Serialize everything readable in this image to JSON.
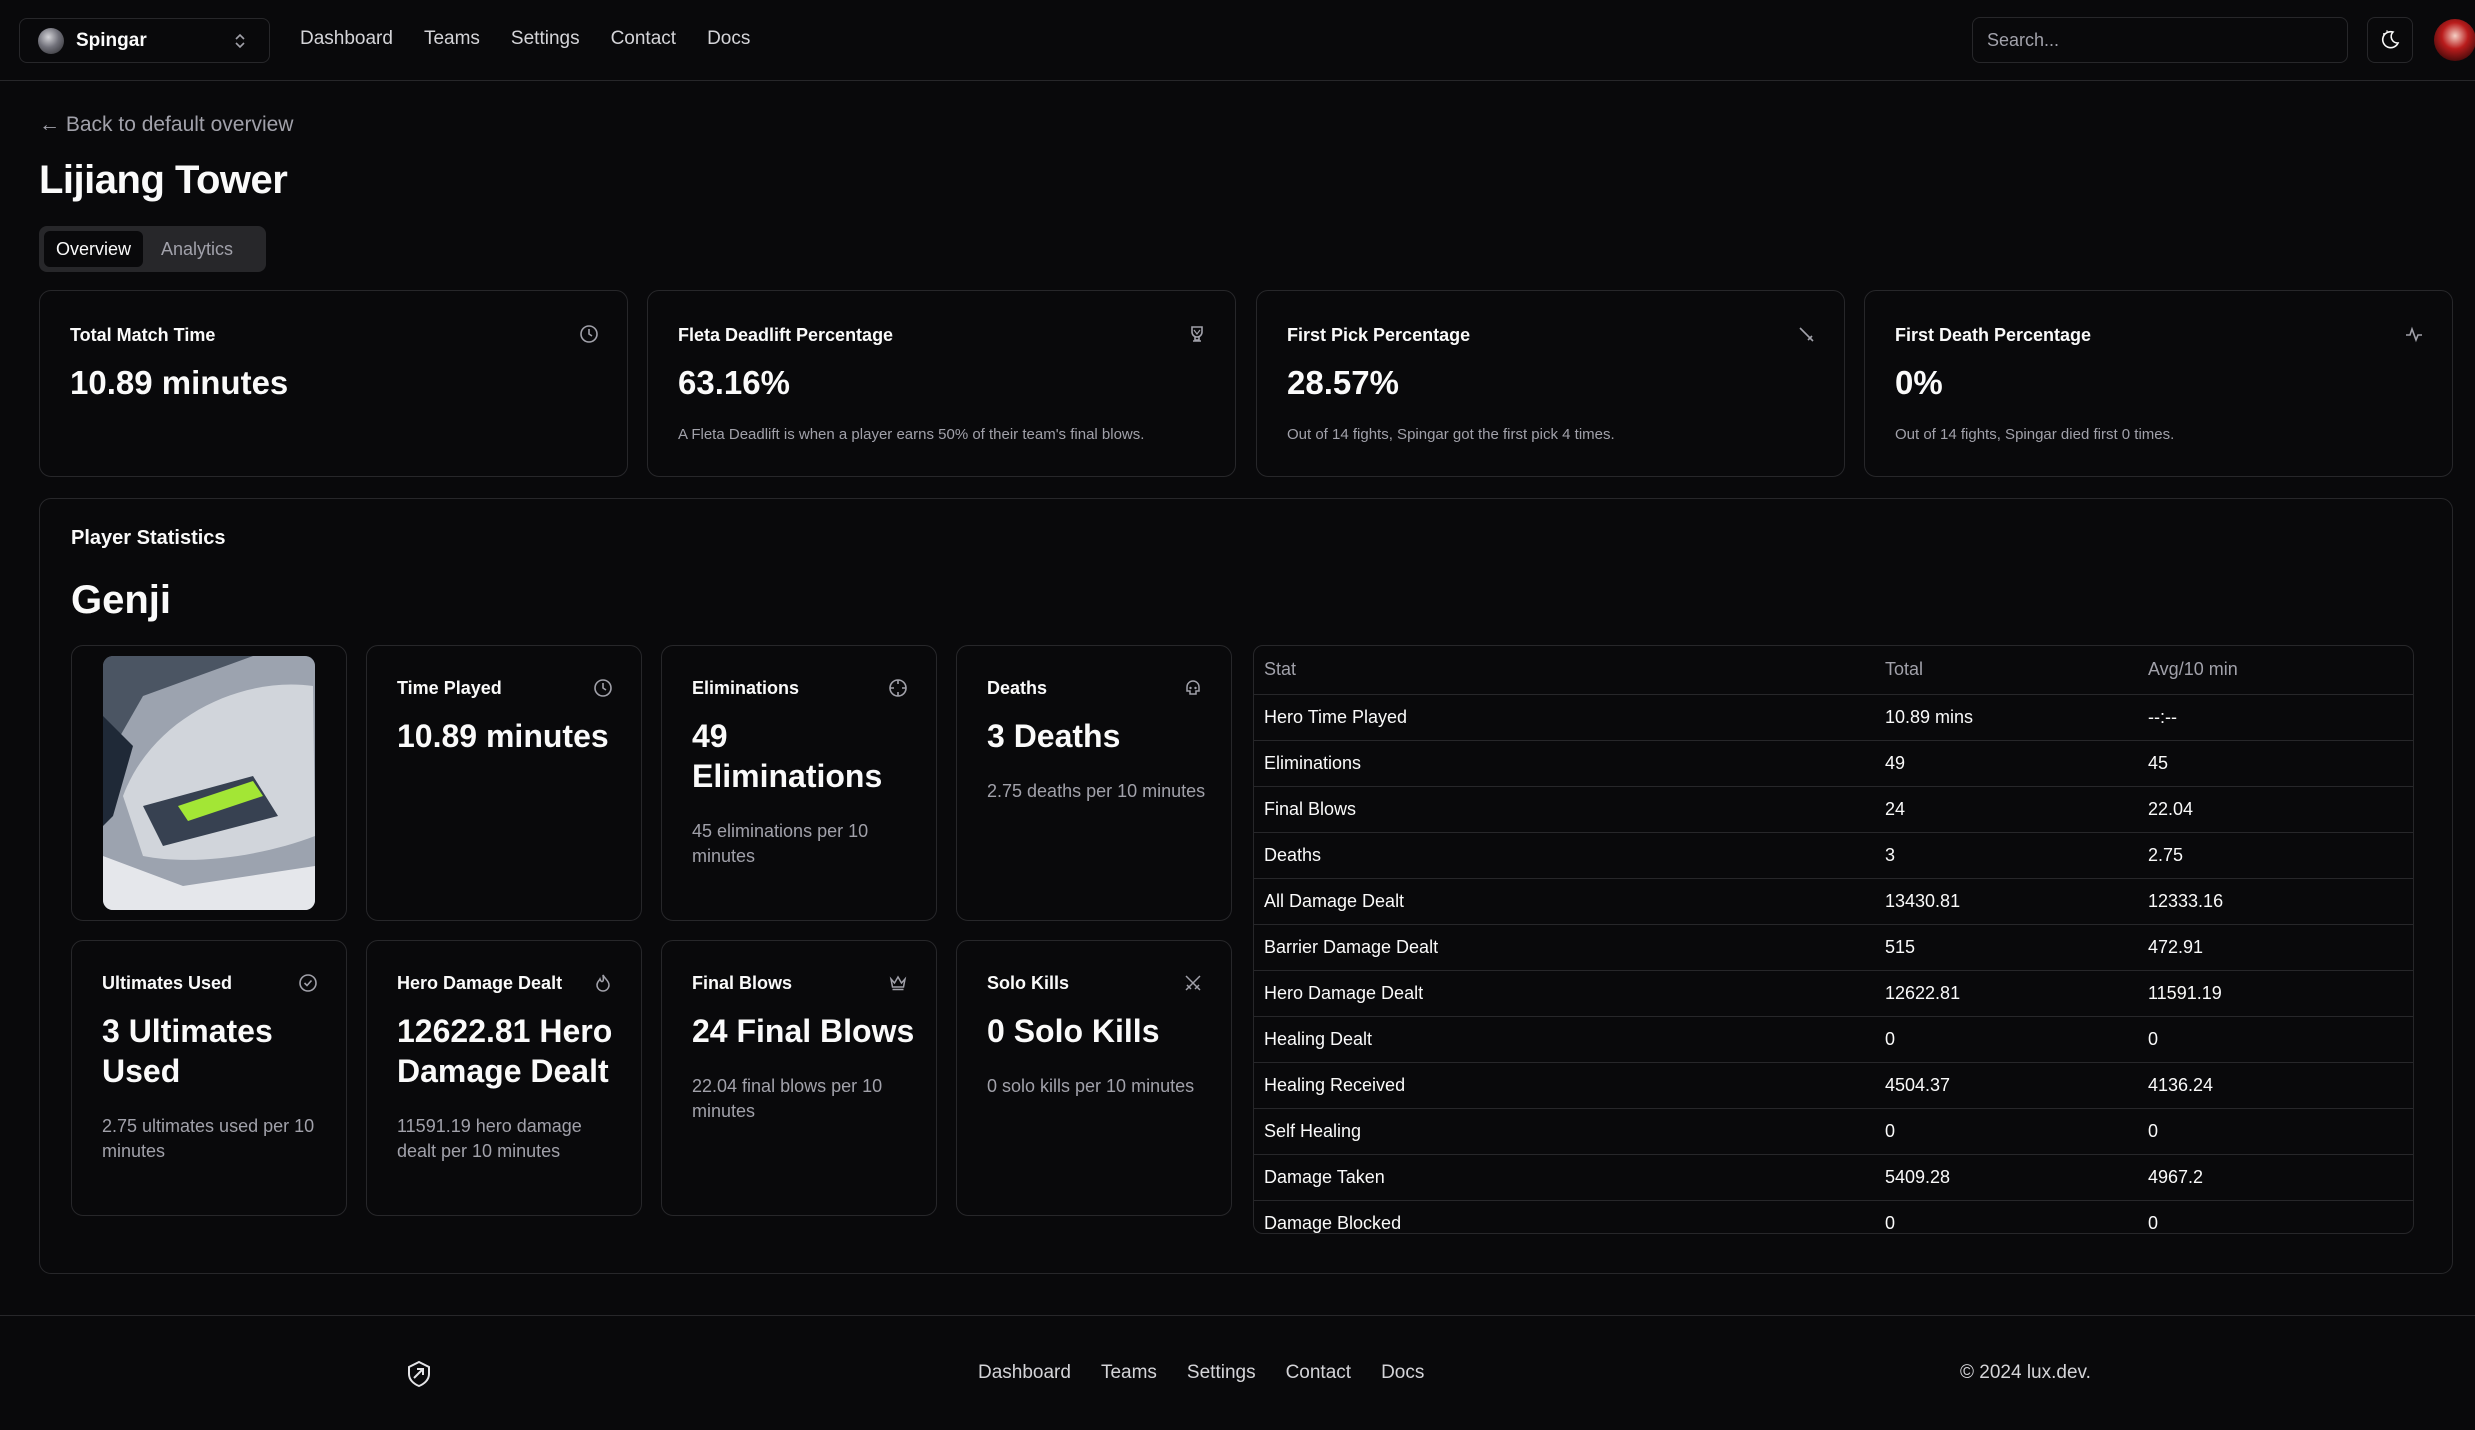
{
  "team": {
    "name": "Spingar"
  },
  "nav": [
    "Dashboard",
    "Teams",
    "Settings",
    "Contact",
    "Docs"
  ],
  "search": {
    "placeholder": "Search..."
  },
  "back_link": "← Back to default overview",
  "page_title": "Lijiang Tower",
  "tabs": [
    "Overview",
    "Analytics"
  ],
  "active_tab": "Overview",
  "summary_cards": [
    {
      "label": "Total Match Time",
      "value": "10.89 minutes",
      "note": "",
      "icon": "clock-icon"
    },
    {
      "label": "Fleta Deadlift Percentage",
      "value": "63.16%",
      "note": "A Fleta Deadlift is when a player earns 50% of their team's final blows.",
      "icon": "trophy-icon"
    },
    {
      "label": "First Pick Percentage",
      "value": "28.57%",
      "note": "Out of 14 fights, Spingar got the first pick 4 times.",
      "icon": "sword-icon"
    },
    {
      "label": "First Death Percentage",
      "value": "0%",
      "note": "Out of 14 fights, Spingar died first 0 times.",
      "icon": "activity-icon"
    }
  ],
  "player_stats": {
    "title": "Player Statistics",
    "hero": "Genji",
    "cards": [
      {
        "label": "Time Played",
        "value": "10.89 minutes",
        "note": "",
        "icon": "clock-icon"
      },
      {
        "label": "Eliminations",
        "value": "49 Eliminations",
        "note": "45 eliminations per 10 minutes",
        "icon": "crosshair-icon"
      },
      {
        "label": "Deaths",
        "value": "3 Deaths",
        "note": "2.75 deaths per 10 minutes",
        "icon": "skull-icon"
      },
      {
        "label": "Ultimates Used",
        "value": "3 Ultimates Used",
        "note": "2.75 ultimates used per 10 minutes",
        "icon": "check-circle-icon"
      },
      {
        "label": "Hero Damage Dealt",
        "value": "12622.81 Hero Damage Dealt",
        "note": "11591.19 hero damage dealt per 10 minutes",
        "icon": "flame-icon"
      },
      {
        "label": "Final Blows",
        "value": "24 Final Blows",
        "note": "22.04 final blows per 10 minutes",
        "icon": "crown-icon"
      },
      {
        "label": "Solo Kills",
        "value": "0 Solo Kills",
        "note": "0 solo kills per 10 minutes",
        "icon": "swords-icon"
      }
    ],
    "table": {
      "headers": [
        "Stat",
        "Total",
        "Avg/10 min"
      ],
      "rows": [
        [
          "Hero Time Played",
          "10.89 mins",
          "--:--"
        ],
        [
          "Eliminations",
          "49",
          "45"
        ],
        [
          "Final Blows",
          "24",
          "22.04"
        ],
        [
          "Deaths",
          "3",
          "2.75"
        ],
        [
          "All Damage Dealt",
          "13430.81",
          "12333.16"
        ],
        [
          "Barrier Damage Dealt",
          "515",
          "472.91"
        ],
        [
          "Hero Damage Dealt",
          "12622.81",
          "11591.19"
        ],
        [
          "Healing Dealt",
          "0",
          "0"
        ],
        [
          "Healing Received",
          "4504.37",
          "4136.24"
        ],
        [
          "Self Healing",
          "0",
          "0"
        ],
        [
          "Damage Taken",
          "5409.28",
          "4967.2"
        ],
        [
          "Damage Blocked",
          "0",
          "0"
        ]
      ]
    }
  },
  "footer": {
    "links": [
      "Dashboard",
      "Teams",
      "Settings",
      "Contact",
      "Docs"
    ],
    "copyright": "© 2024 lux.dev."
  }
}
